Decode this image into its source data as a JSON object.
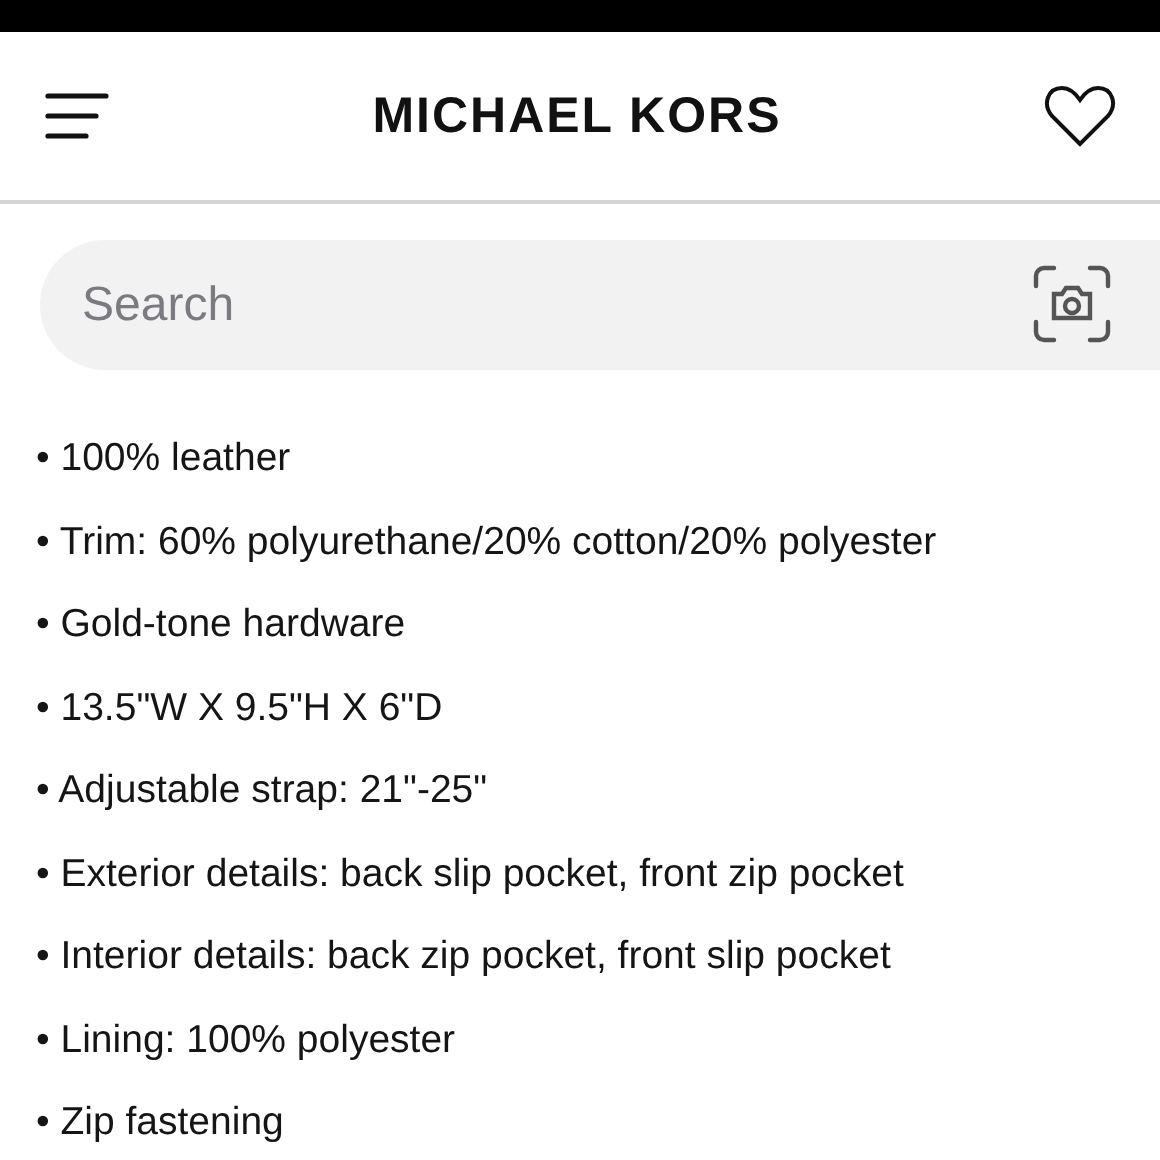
{
  "header": {
    "brand": "MICHAEL KORS"
  },
  "search": {
    "placeholder": "Search"
  },
  "details": [
    {
      "text": "• 100% leather"
    },
    {
      "text": "• Trim: 60% polyurethane/20% cotton/20% polyester"
    },
    {
      "text": "• Gold-tone hardware"
    },
    {
      "text": "• 13.5\"W X 9.5\"H X 6\"D"
    },
    {
      "text": "• Adjustable strap: 21\"-25\""
    },
    {
      "text": "• Exterior details: back slip pocket, front zip pocket"
    },
    {
      "text": "• Interior details: back zip pocket, front slip pocket"
    },
    {
      "text": "• Lining: 100% polyester"
    },
    {
      "text": "• Zip fastening"
    }
  ]
}
